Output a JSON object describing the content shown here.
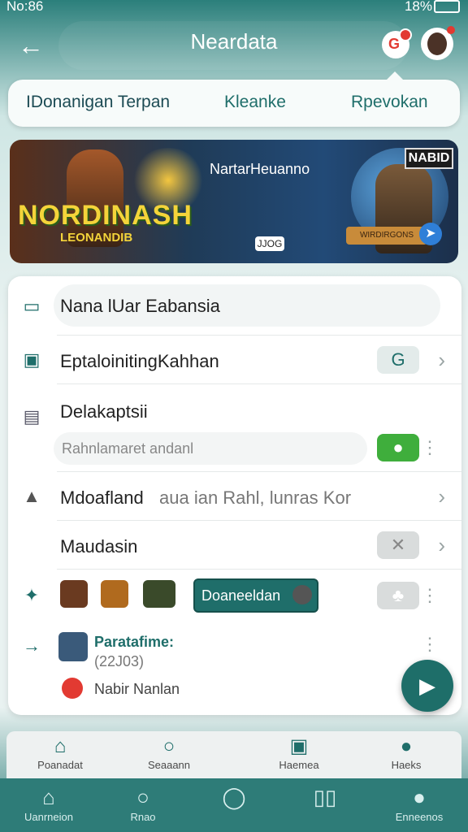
{
  "status": {
    "time": "No:86",
    "battery": "18%"
  },
  "header": {
    "title": "Neardata"
  },
  "tabs": [
    "IDonanigan Terpan",
    "Kleanke",
    "Rpevokan"
  ],
  "banner": {
    "title": "NORDINASH",
    "subtitle": "LEONANDIB",
    "caption": "NartarHeuanno",
    "chip": "JJOG",
    "badge": "NABID",
    "ribbon": "WIRDIRGONS"
  },
  "list": {
    "search_label": "Nana lUar Eabansia",
    "row1": {
      "label": "EptaloinitingKahhan",
      "badge": "G"
    },
    "row2": {
      "label": "Delakaptsii",
      "subtext": "Rahnlamaret andanl"
    },
    "row3": {
      "label": "Mdoafland",
      "secondary": "aua ian Rahl, lunras Kor"
    },
    "row4": {
      "label": "Maudasin"
    },
    "row5": {
      "button": "Doaneeldan"
    },
    "row6": {
      "title": "Paratafime:",
      "subtitle": "(22J03)",
      "footer": "Nabir Nanlan"
    }
  },
  "bottom_nav": [
    "Poanadat",
    "Seaaann",
    "Haemea",
    "Haeks"
  ],
  "system_nav": [
    "Uanrneion",
    "Rnao",
    "",
    "",
    "Enneenos"
  ],
  "colors": {
    "primary": "#1f6e6a",
    "accent_green": "#3fae3c",
    "badge_red": "#e23a32"
  }
}
